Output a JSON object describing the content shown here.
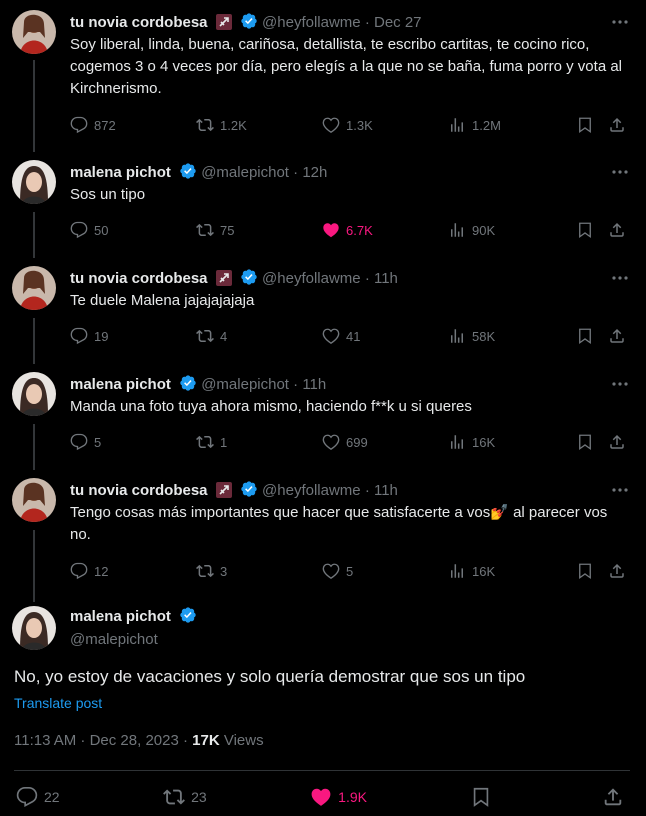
{
  "colors": {
    "background": "#000000",
    "text": "#e7e9ea",
    "muted": "#71767b",
    "accent": "#1d9bf0",
    "like": "#f91880",
    "verified": "#1d9bf0"
  },
  "tweets": [
    {
      "name": "tu novia cordobesa",
      "handle": "@heyfollawme",
      "time": "· Dec 27",
      "text": "Soy liberal, linda, buena, cariñosa, detallista, te escribo cartitas, te cocino rico, cogemos 3 o 4 veces por día, pero elegís a la que no se baña, fuma porro y vota al Kirchnerismo.",
      "replies": "872",
      "reposts": "1.2K",
      "likes": "1.3K",
      "views": "1.2M",
      "liked": false
    },
    {
      "name": "malena pichot",
      "handle": "@malepichot",
      "time": "· 12h",
      "text": "Sos un tipo",
      "replies": "50",
      "reposts": "75",
      "likes": "6.7K",
      "views": "90K",
      "liked": true
    },
    {
      "name": "tu novia cordobesa",
      "handle": "@heyfollawme",
      "time": "· 11h",
      "text": "Te duele Malena jajajajajaja",
      "replies": "19",
      "reposts": "4",
      "likes": "41",
      "views": "58K",
      "liked": false
    },
    {
      "name": "malena pichot",
      "handle": "@malepichot",
      "time": "· 11h",
      "text": "Manda una foto tuya ahora mismo, haciendo f**k u si queres",
      "replies": "5",
      "reposts": "1",
      "likes": "699",
      "views": "16K",
      "liked": false
    },
    {
      "name": "tu novia cordobesa",
      "handle": "@heyfollawme",
      "time": "· 11h",
      "text": "Tengo cosas más importantes que hacer que satisfacerte a vos💅 al parecer vos no.",
      "replies": "12",
      "reposts": "3",
      "likes": "5",
      "views": "16K",
      "liked": false
    }
  ],
  "main_tweet": {
    "name": "malena pichot",
    "handle": "@malepichot",
    "text": "No, yo estoy de vacaciones y solo quería demostrar que sos un tipo",
    "translate_label": "Translate post",
    "timestamp": "11:13 AM · Dec 28, 2023 · ",
    "views_count": "17K",
    "views_label": " Views",
    "replies": "22",
    "reposts": "23",
    "likes": "1.9K",
    "liked": true
  }
}
